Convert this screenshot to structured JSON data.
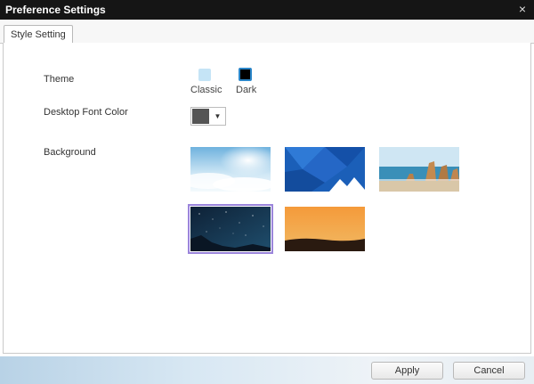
{
  "window": {
    "title": "Preference Settings",
    "close_glyph": "×"
  },
  "tabs": [
    {
      "label": "Style Setting",
      "active": true
    }
  ],
  "theme": {
    "label": "Theme",
    "options": [
      {
        "caption": "Classic",
        "color": "#c5e4f6",
        "icon": "theme-classic-swatch"
      },
      {
        "caption": "Dark",
        "color": "#000000",
        "icon": "theme-dark-swatch",
        "selected": true
      }
    ]
  },
  "font_color": {
    "label": "Desktop Font Color",
    "value_color": "#555555",
    "dropdown_glyph": "▼"
  },
  "background": {
    "label": "Background",
    "thumbnails": [
      {
        "name": "sky-sun",
        "selected": false
      },
      {
        "name": "blue-geometric",
        "selected": false
      },
      {
        "name": "coastal-rocks",
        "selected": false
      },
      {
        "name": "starry-night",
        "selected": true
      },
      {
        "name": "orange-sunset",
        "selected": false
      }
    ]
  },
  "footer": {
    "apply_label": "Apply",
    "cancel_label": "Cancel"
  },
  "colors": {
    "titlebar": "#151515",
    "selection_outline": "#9b85db",
    "dark_theme_border": "#2b86c9"
  }
}
